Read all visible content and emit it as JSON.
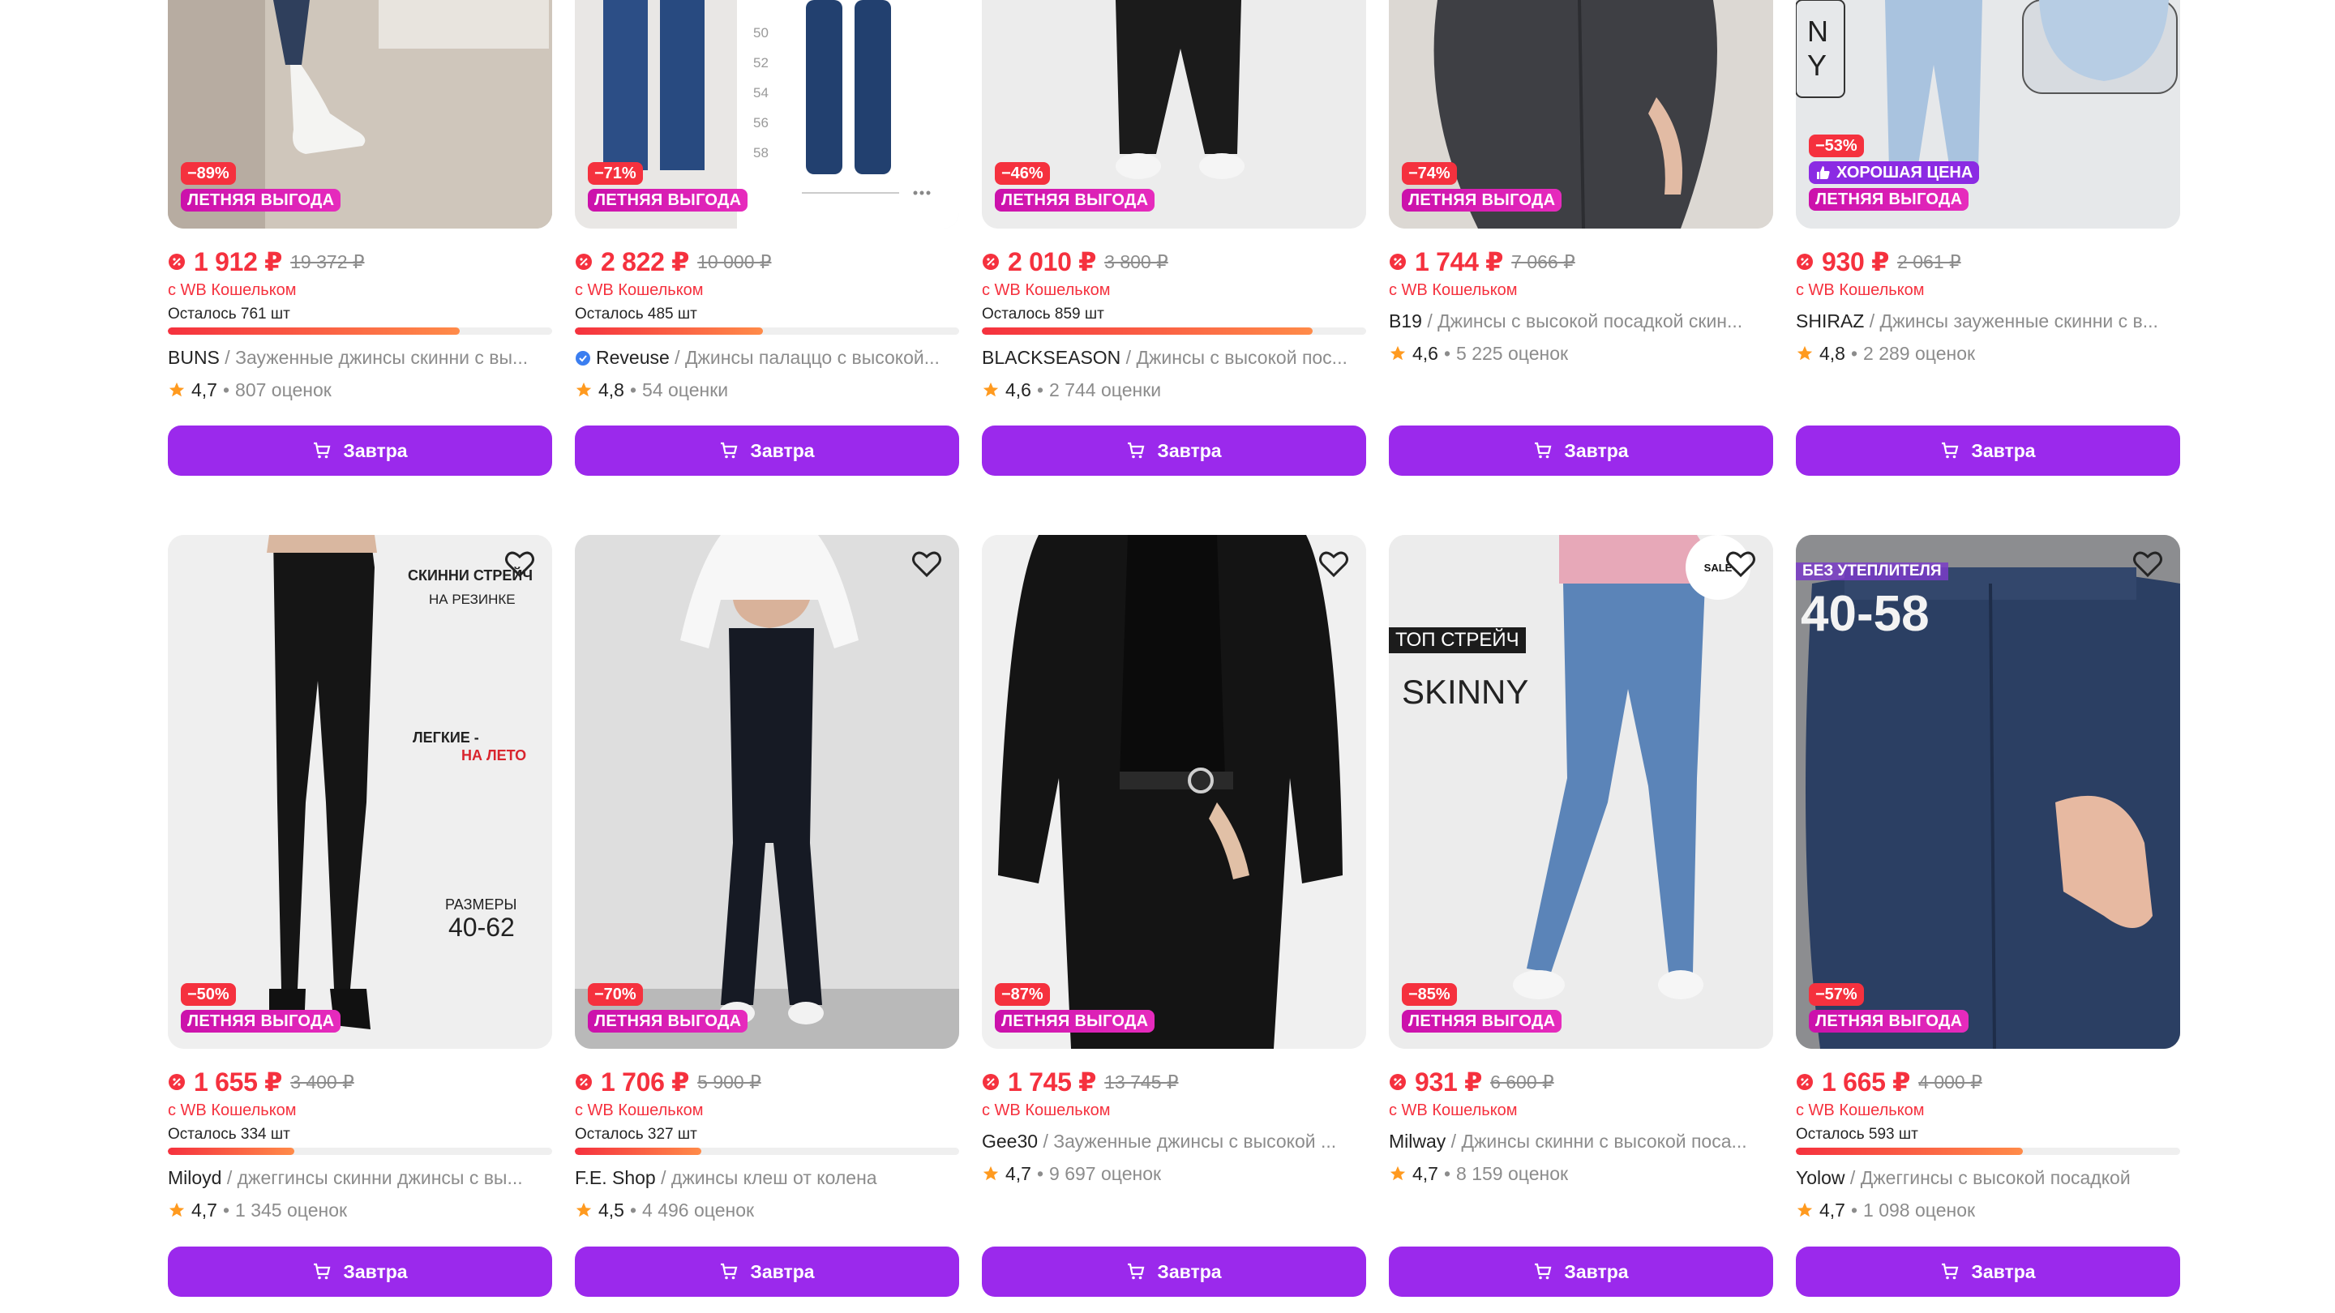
{
  "colors": {
    "accent": "#9b29ec",
    "price": "#f5313e",
    "promo": "#cb11ab",
    "star": "#ff9a1f"
  },
  "cart_label": "Завтра",
  "wallet_label": "с WB Кошельком",
  "row1": [
    {
      "discount": "−89%",
      "promo": "ЛЕТНЯЯ ВЫГОДА",
      "price": "1 912 ₽",
      "old_price": "19 372 ₽",
      "stock": "Осталось 761 шт",
      "stock_fraction": 0.76,
      "brand": "BUNS",
      "name": " / Зауженные джинсы скинни с вы...",
      "rating": "4,7",
      "reviews": "807 оценок"
    },
    {
      "discount": "−71%",
      "promo": "ЛЕТНЯЯ ВЫГОДА",
      "price": "2 822 ₽",
      "old_price": "10 000 ₽",
      "stock": "Осталось 485 шт",
      "stock_fraction": 0.49,
      "brand": "Reveuse",
      "name": " / Джинсы палаццо с высокой...",
      "rating": "4,8",
      "reviews": "54 оценки",
      "verified": true,
      "size_labels": [
        "50",
        "52",
        "54",
        "56",
        "58"
      ]
    },
    {
      "discount": "−46%",
      "promo": "ЛЕТНЯЯ ВЫГОДА",
      "price": "2 010 ₽",
      "old_price": "3 800 ₽",
      "stock": "Осталось 859 шт",
      "stock_fraction": 0.86,
      "brand": "BLACKSEASON",
      "name": " / Джинсы с высокой пос...",
      "rating": "4,6",
      "reviews": "2 744 оценки"
    },
    {
      "discount": "−74%",
      "promo": "ЛЕТНЯЯ ВЫГОДА",
      "price": "1 744 ₽",
      "old_price": "7 066 ₽",
      "brand": "B19",
      "name": " / Джинсы с высокой посадкой скин...",
      "rating": "4,6",
      "reviews": "5 225 оценок"
    },
    {
      "discount": "−53%",
      "good_price": "ХОРОШАЯ ЦЕНА",
      "promo": "ЛЕТНЯЯ ВЫГОДА",
      "price": "930 ₽",
      "old_price": "2 061 ₽",
      "brand": "SHIRAZ",
      "name": " / Джинсы зауженные скинни с в...",
      "rating": "4,8",
      "reviews": "2 289 оценок",
      "photo_letters": [
        "N",
        "Y"
      ]
    }
  ],
  "row2": [
    {
      "discount": "−50%",
      "promo": "ЛЕТНЯЯ ВЫГОДА",
      "price": "1 655 ₽",
      "old_price": "3 400 ₽",
      "stock": "Осталось 334 шт",
      "stock_fraction": 0.33,
      "brand": "Miloyd",
      "name": " / джеггинсы скинни джинсы с вы...",
      "rating": "4,7",
      "reviews": "1 345 оценок",
      "overlay": {
        "t1": "СКИННИ СТРЕЙЧ",
        "t2": "НА РЕЗИНКЕ",
        "t3": "ЛЕГКИЕ -",
        "t4": "НА ЛЕТО",
        "t5": "РАЗМЕРЫ",
        "t6": "40-62"
      }
    },
    {
      "discount": "−70%",
      "promo": "ЛЕТНЯЯ ВЫГОДА",
      "price": "1 706 ₽",
      "old_price": "5 900 ₽",
      "stock": "Осталось 327 шт",
      "stock_fraction": 0.33,
      "brand": "F.E. Shop",
      "name": " / джинсы клеш от колена",
      "rating": "4,5",
      "reviews": "4 496 оценок"
    },
    {
      "discount": "−87%",
      "promo": "ЛЕТНЯЯ ВЫГОДА",
      "price": "1 745 ₽",
      "old_price": "13 745 ₽",
      "brand": "Gee30",
      "name": " / Зауженные джинсы с высокой ...",
      "rating": "4,7",
      "reviews": "9 697 оценок"
    },
    {
      "discount": "−85%",
      "promo": "ЛЕТНЯЯ ВЫГОДА",
      "price": "931 ₽",
      "old_price": "6 600 ₽",
      "brand": "Milway",
      "name": " / Джинсы скинни с высокой поса...",
      "rating": "4,7",
      "reviews": "8 159 оценок",
      "overlay": {
        "t1": "ТОП СТРЕЙЧ",
        "t2": "SKINNY",
        "t3": "SALE"
      }
    },
    {
      "discount": "−57%",
      "promo": "ЛЕТНЯЯ ВЫГОДА",
      "price": "1 665 ₽",
      "old_price": "4 000 ₽",
      "stock": "Осталось 593 шт",
      "stock_fraction": 0.59,
      "brand": "Yolow",
      "name": " / Джеггинсы с высокой посадкой",
      "rating": "4,7",
      "reviews": "1 098 оценок",
      "overlay": {
        "t1": "БЕЗ УТЕПЛИТЕЛЯ",
        "t2": "40-58"
      }
    }
  ]
}
